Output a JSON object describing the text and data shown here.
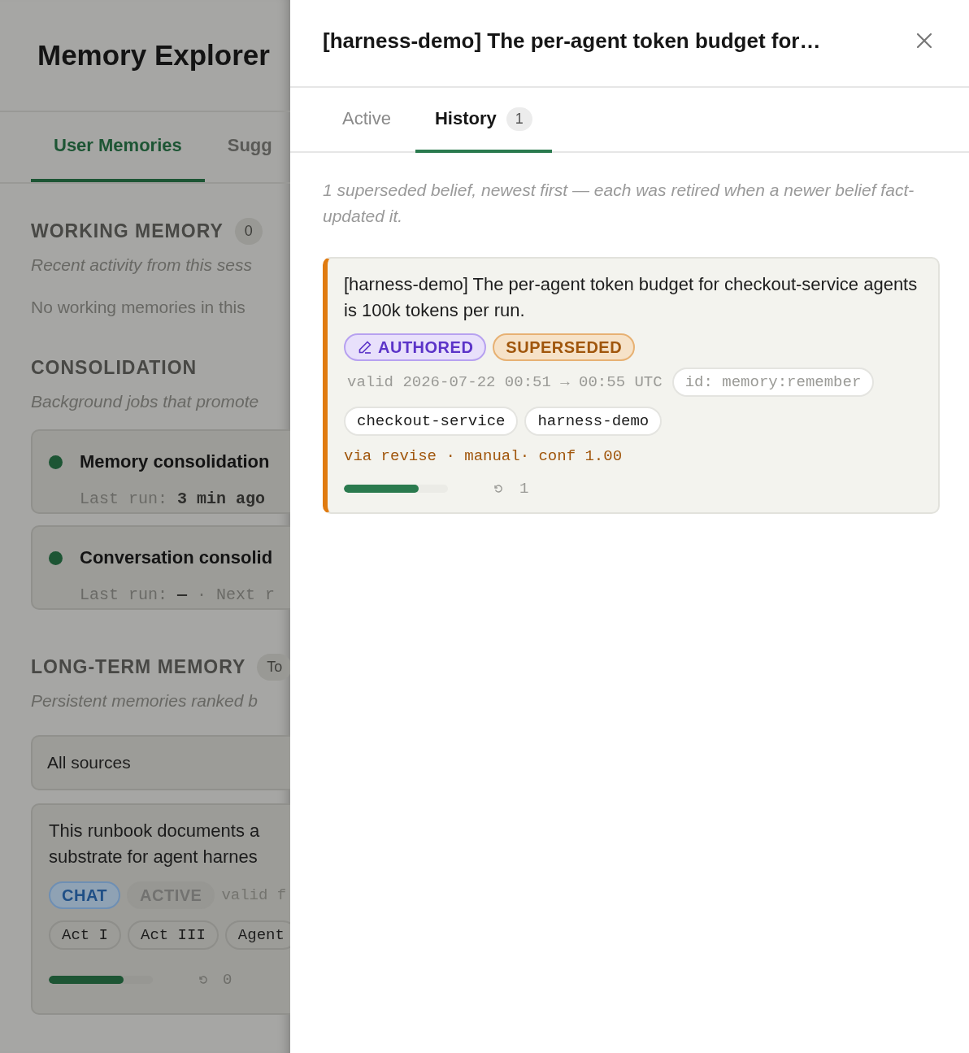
{
  "page": {
    "title": "Memory Explorer",
    "tabs": [
      {
        "label": "User Memories",
        "selected": true
      },
      {
        "label": "Sugg",
        "selected": false
      }
    ],
    "working_memory": {
      "heading": "WORKING MEMORY",
      "count": "0",
      "description": "Recent activity from this sess",
      "empty": "No working memories in this"
    },
    "consolidation": {
      "heading": "CONSOLIDATION",
      "description": "Background jobs that promote",
      "jobs": [
        {
          "name": "Memory consolidation",
          "label": "Last run:",
          "value": "3 min ago"
        },
        {
          "name": "Conversation consolid",
          "label": "Last run:",
          "value": "—",
          "separator": "·",
          "extra": "Next r"
        }
      ]
    },
    "long_term": {
      "heading": "LONG-TERM MEMORY",
      "count": "To",
      "description": "Persistent memories ranked b",
      "filter": "All sources",
      "memory": {
        "lines": [
          "This runbook documents a",
          "substrate for agent harnes"
        ],
        "badges": [
          {
            "kind": "chat",
            "label": "CHAT"
          },
          {
            "kind": "active",
            "label": "ACTIVE"
          }
        ],
        "validity": "valid f",
        "tags": [
          "Act I",
          "Act III",
          "Agent"
        ],
        "level": 0.72,
        "revisions": "0"
      }
    }
  },
  "drawer": {
    "title": "[harness-demo] The per-agent token budget for…",
    "tabs": [
      {
        "label": "Active",
        "selected": false
      },
      {
        "label": "History",
        "selected": true,
        "count": "1"
      }
    ],
    "description": "1 superseded belief, newest first — each was retired when a newer belief fact-updated it.",
    "memory": {
      "text": "[harness-demo] The per-agent token budget for checkout-service agents is 100k tokens per run.",
      "badges": [
        {
          "kind": "authored",
          "label": "AUTHORED"
        },
        {
          "kind": "superseded",
          "label": "SUPERSEDED"
        }
      ],
      "validity": "valid 2026-07-22 00:51 → 00:55 UTC",
      "id": "id: memory:remember",
      "tags": [
        "checkout-service",
        "harness-demo"
      ],
      "provenance": "via revise · manual· conf 1.00",
      "level": 0.72,
      "revisions": "1"
    }
  }
}
